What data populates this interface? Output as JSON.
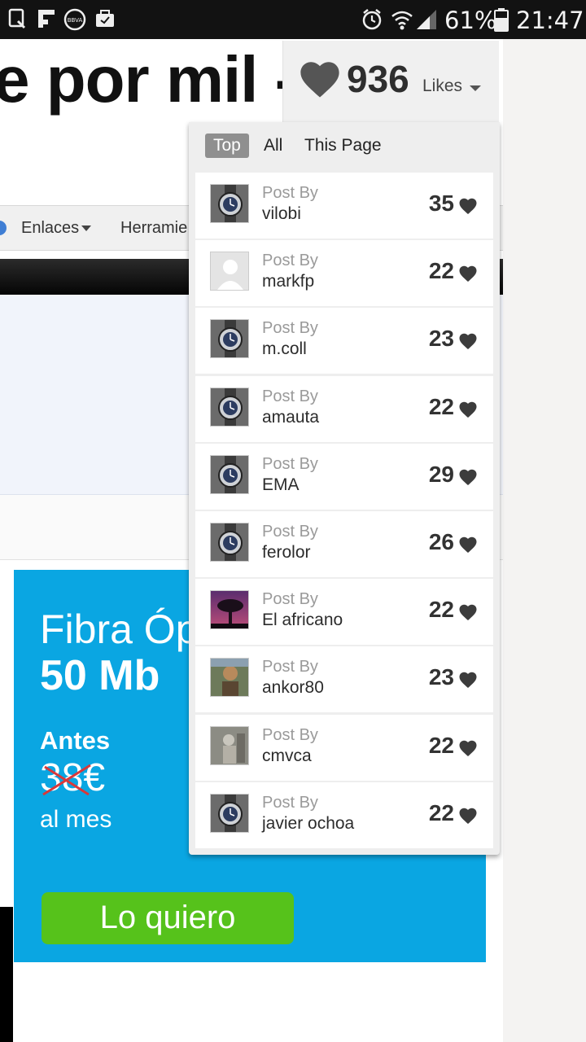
{
  "status_bar": {
    "battery": "61%",
    "time": "21:47",
    "icons": [
      "screenshot-icon",
      "flipboard-icon",
      "bbva-icon",
      "briefcase-icon",
      "alarm-icon",
      "wifi-icon",
      "signal-icon",
      "battery-icon"
    ]
  },
  "page": {
    "title": "e por mil -",
    "nav": {
      "item1": "Enlaces",
      "item2": "Herramie"
    },
    "ad": {
      "title": "Fibra Óp",
      "speed": "50 Mb",
      "antes": "Antes",
      "old_price": "38€",
      "per_month": "al mes",
      "cta": "Lo quiero",
      "bg_color": "#0aa6e2",
      "button_color": "#56c21b"
    }
  },
  "likes": {
    "count": "936",
    "label": "Likes",
    "tabs": [
      "Top",
      "All",
      "This Page"
    ],
    "active_tab": "Top",
    "items": [
      {
        "post_by": "Post By",
        "author": "vilobi",
        "count": "35",
        "avatar": "watch"
      },
      {
        "post_by": "Post By",
        "author": "markfp",
        "count": "22",
        "avatar": "default"
      },
      {
        "post_by": "Post By",
        "author": "m.coll",
        "count": "23",
        "avatar": "watch"
      },
      {
        "post_by": "Post By",
        "author": "amauta",
        "count": "22",
        "avatar": "watch"
      },
      {
        "post_by": "Post By",
        "author": "EMA",
        "count": "29",
        "avatar": "watch"
      },
      {
        "post_by": "Post By",
        "author": "ferolor",
        "count": "26",
        "avatar": "watch"
      },
      {
        "post_by": "Post By",
        "author": "El africano",
        "count": "22",
        "avatar": "tree"
      },
      {
        "post_by": "Post By",
        "author": "ankor80",
        "count": "23",
        "avatar": "person"
      },
      {
        "post_by": "Post By",
        "author": "cmvca",
        "count": "22",
        "avatar": "statue"
      },
      {
        "post_by": "Post By",
        "author": "javier ochoa",
        "count": "22",
        "avatar": "watch"
      }
    ]
  }
}
